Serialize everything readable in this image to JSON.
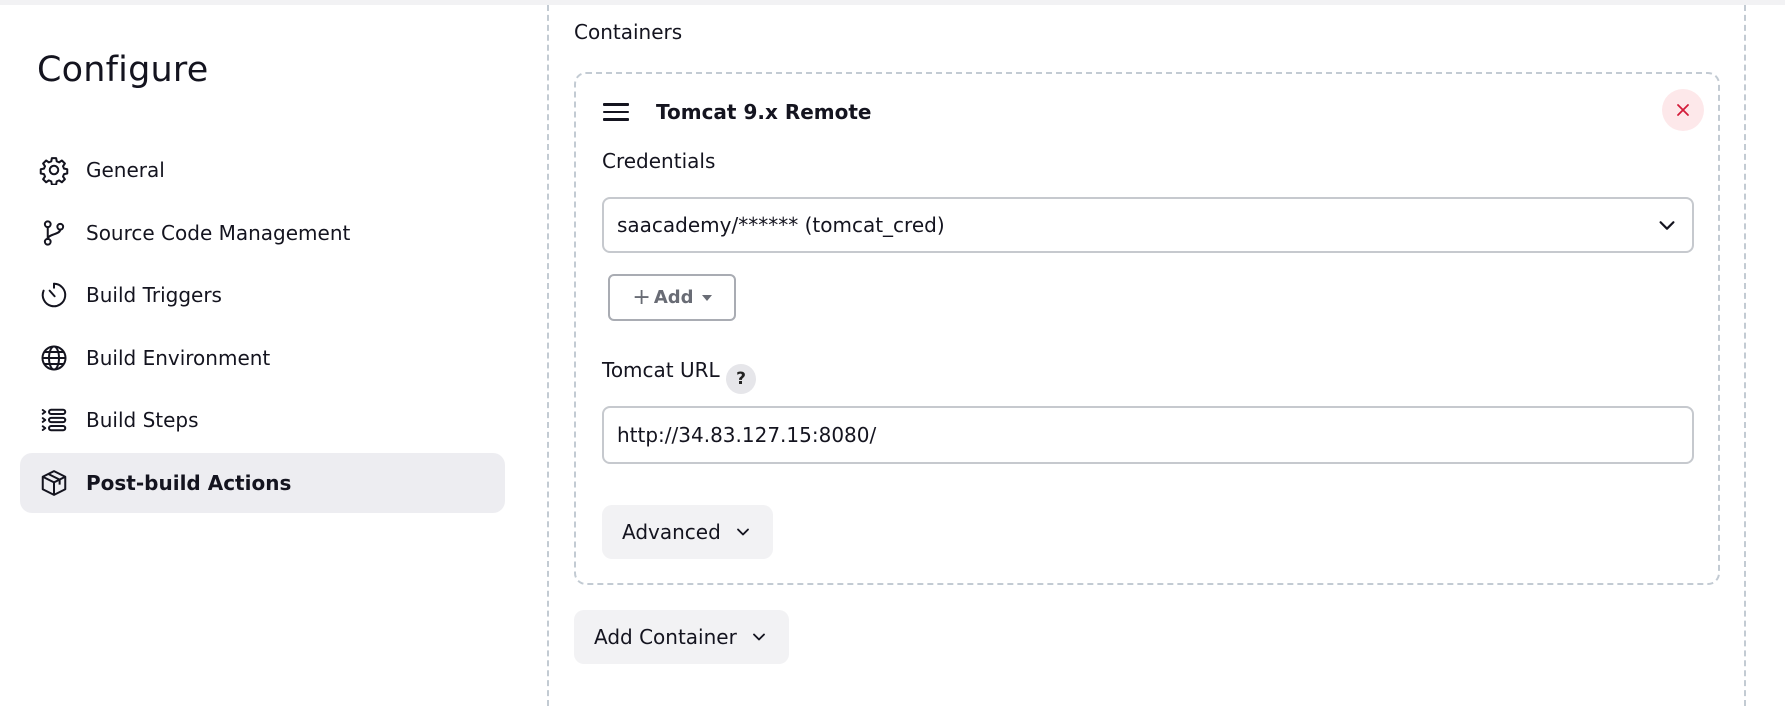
{
  "page": {
    "title": "Configure"
  },
  "sidebar": {
    "items": [
      {
        "label": "General",
        "icon": "gear-icon",
        "active": false
      },
      {
        "label": "Source Code Management",
        "icon": "git-branch-icon",
        "active": false
      },
      {
        "label": "Build Triggers",
        "icon": "timer-icon",
        "active": false
      },
      {
        "label": "Build Environment",
        "icon": "globe-icon",
        "active": false
      },
      {
        "label": "Build Steps",
        "icon": "list-icon",
        "active": false
      },
      {
        "label": "Post-build Actions",
        "icon": "package-icon",
        "active": true
      }
    ]
  },
  "main": {
    "section_title": "Containers",
    "container": {
      "title": "Tomcat 9.x Remote",
      "credentials_label": "Credentials",
      "credentials_value": "saacademy/****** (tomcat_cred)",
      "add_label": "Add",
      "url_label": "Tomcat URL",
      "help_label": "?",
      "url_value": "http://34.83.127.15:8080/",
      "advanced_label": "Advanced"
    },
    "add_container_label": "Add Container"
  },
  "colors": {
    "active_bg": "#ededf1",
    "delete_bg": "#fde8ea",
    "delete_icon": "#d31b3a",
    "dashed_border": "#c3cbd3"
  }
}
